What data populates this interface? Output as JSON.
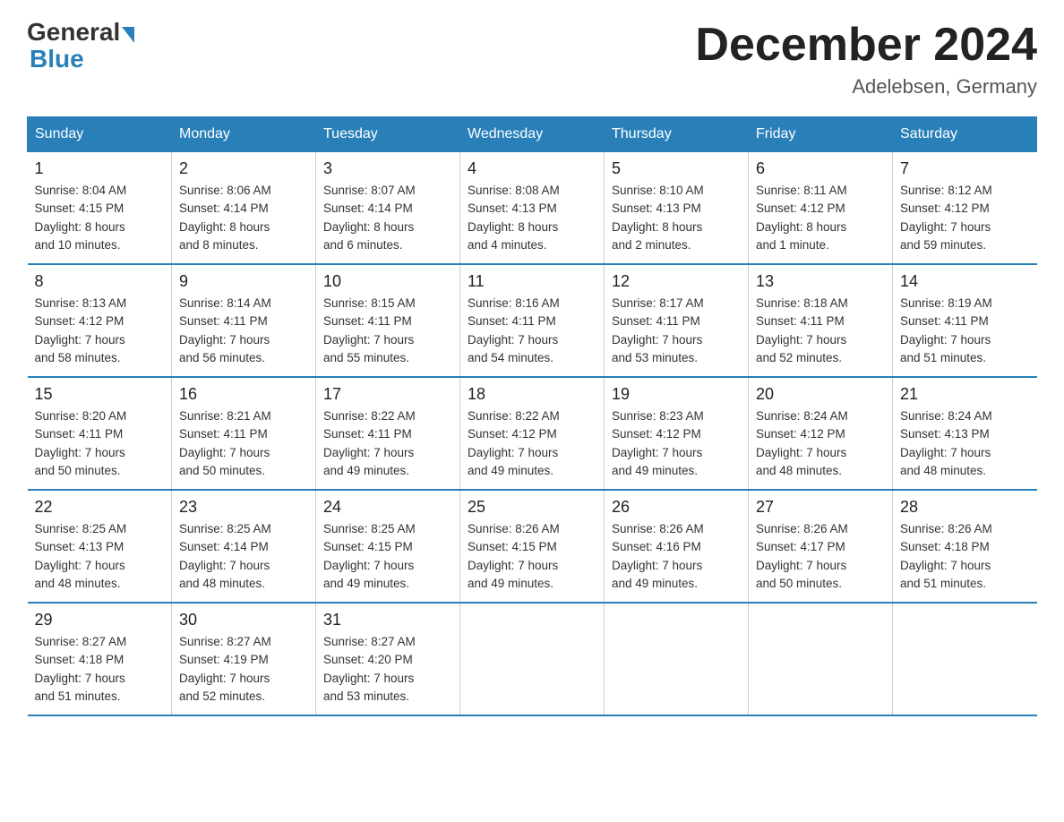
{
  "logo": {
    "general": "General",
    "blue": "Blue"
  },
  "title": "December 2024",
  "location": "Adelebsen, Germany",
  "days_of_week": [
    "Sunday",
    "Monday",
    "Tuesday",
    "Wednesday",
    "Thursday",
    "Friday",
    "Saturday"
  ],
  "weeks": [
    [
      {
        "day": "1",
        "info": "Sunrise: 8:04 AM\nSunset: 4:15 PM\nDaylight: 8 hours\nand 10 minutes."
      },
      {
        "day": "2",
        "info": "Sunrise: 8:06 AM\nSunset: 4:14 PM\nDaylight: 8 hours\nand 8 minutes."
      },
      {
        "day": "3",
        "info": "Sunrise: 8:07 AM\nSunset: 4:14 PM\nDaylight: 8 hours\nand 6 minutes."
      },
      {
        "day": "4",
        "info": "Sunrise: 8:08 AM\nSunset: 4:13 PM\nDaylight: 8 hours\nand 4 minutes."
      },
      {
        "day": "5",
        "info": "Sunrise: 8:10 AM\nSunset: 4:13 PM\nDaylight: 8 hours\nand 2 minutes."
      },
      {
        "day": "6",
        "info": "Sunrise: 8:11 AM\nSunset: 4:12 PM\nDaylight: 8 hours\nand 1 minute."
      },
      {
        "day": "7",
        "info": "Sunrise: 8:12 AM\nSunset: 4:12 PM\nDaylight: 7 hours\nand 59 minutes."
      }
    ],
    [
      {
        "day": "8",
        "info": "Sunrise: 8:13 AM\nSunset: 4:12 PM\nDaylight: 7 hours\nand 58 minutes."
      },
      {
        "day": "9",
        "info": "Sunrise: 8:14 AM\nSunset: 4:11 PM\nDaylight: 7 hours\nand 56 minutes."
      },
      {
        "day": "10",
        "info": "Sunrise: 8:15 AM\nSunset: 4:11 PM\nDaylight: 7 hours\nand 55 minutes."
      },
      {
        "day": "11",
        "info": "Sunrise: 8:16 AM\nSunset: 4:11 PM\nDaylight: 7 hours\nand 54 minutes."
      },
      {
        "day": "12",
        "info": "Sunrise: 8:17 AM\nSunset: 4:11 PM\nDaylight: 7 hours\nand 53 minutes."
      },
      {
        "day": "13",
        "info": "Sunrise: 8:18 AM\nSunset: 4:11 PM\nDaylight: 7 hours\nand 52 minutes."
      },
      {
        "day": "14",
        "info": "Sunrise: 8:19 AM\nSunset: 4:11 PM\nDaylight: 7 hours\nand 51 minutes."
      }
    ],
    [
      {
        "day": "15",
        "info": "Sunrise: 8:20 AM\nSunset: 4:11 PM\nDaylight: 7 hours\nand 50 minutes."
      },
      {
        "day": "16",
        "info": "Sunrise: 8:21 AM\nSunset: 4:11 PM\nDaylight: 7 hours\nand 50 minutes."
      },
      {
        "day": "17",
        "info": "Sunrise: 8:22 AM\nSunset: 4:11 PM\nDaylight: 7 hours\nand 49 minutes."
      },
      {
        "day": "18",
        "info": "Sunrise: 8:22 AM\nSunset: 4:12 PM\nDaylight: 7 hours\nand 49 minutes."
      },
      {
        "day": "19",
        "info": "Sunrise: 8:23 AM\nSunset: 4:12 PM\nDaylight: 7 hours\nand 49 minutes."
      },
      {
        "day": "20",
        "info": "Sunrise: 8:24 AM\nSunset: 4:12 PM\nDaylight: 7 hours\nand 48 minutes."
      },
      {
        "day": "21",
        "info": "Sunrise: 8:24 AM\nSunset: 4:13 PM\nDaylight: 7 hours\nand 48 minutes."
      }
    ],
    [
      {
        "day": "22",
        "info": "Sunrise: 8:25 AM\nSunset: 4:13 PM\nDaylight: 7 hours\nand 48 minutes."
      },
      {
        "day": "23",
        "info": "Sunrise: 8:25 AM\nSunset: 4:14 PM\nDaylight: 7 hours\nand 48 minutes."
      },
      {
        "day": "24",
        "info": "Sunrise: 8:25 AM\nSunset: 4:15 PM\nDaylight: 7 hours\nand 49 minutes."
      },
      {
        "day": "25",
        "info": "Sunrise: 8:26 AM\nSunset: 4:15 PM\nDaylight: 7 hours\nand 49 minutes."
      },
      {
        "day": "26",
        "info": "Sunrise: 8:26 AM\nSunset: 4:16 PM\nDaylight: 7 hours\nand 49 minutes."
      },
      {
        "day": "27",
        "info": "Sunrise: 8:26 AM\nSunset: 4:17 PM\nDaylight: 7 hours\nand 50 minutes."
      },
      {
        "day": "28",
        "info": "Sunrise: 8:26 AM\nSunset: 4:18 PM\nDaylight: 7 hours\nand 51 minutes."
      }
    ],
    [
      {
        "day": "29",
        "info": "Sunrise: 8:27 AM\nSunset: 4:18 PM\nDaylight: 7 hours\nand 51 minutes."
      },
      {
        "day": "30",
        "info": "Sunrise: 8:27 AM\nSunset: 4:19 PM\nDaylight: 7 hours\nand 52 minutes."
      },
      {
        "day": "31",
        "info": "Sunrise: 8:27 AM\nSunset: 4:20 PM\nDaylight: 7 hours\nand 53 minutes."
      },
      null,
      null,
      null,
      null
    ]
  ]
}
